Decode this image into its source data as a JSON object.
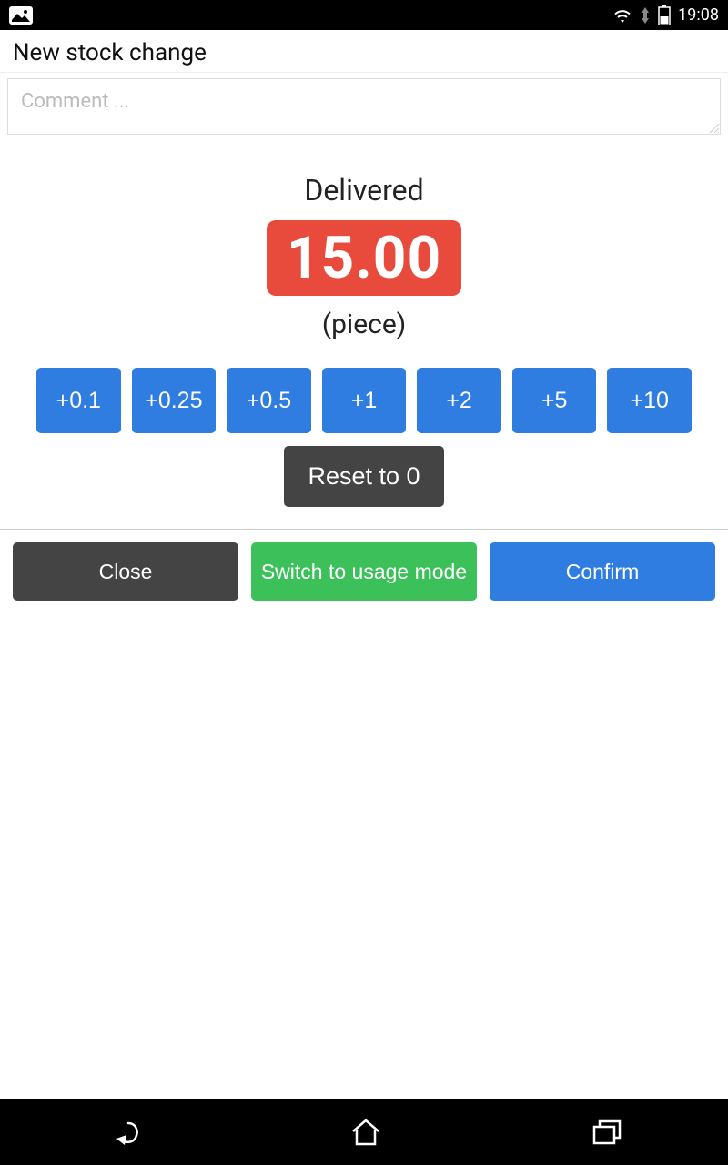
{
  "status_bar": {
    "time": "19:08"
  },
  "header": {
    "title": "New stock change"
  },
  "comment": {
    "placeholder": "Comment ...",
    "value": ""
  },
  "delivered": {
    "label": "Delivered",
    "value": "15.00",
    "unit": "(piece)"
  },
  "increments": [
    "+0.1",
    "+0.25",
    "+0.5",
    "+1",
    "+2",
    "+5",
    "+10"
  ],
  "reset_label": "Reset to 0",
  "actions": {
    "close": "Close",
    "switch": "Switch to usage mode",
    "confirm": "Confirm"
  },
  "colors": {
    "value_bg": "#e84b3c",
    "blue": "#2f7de1",
    "green": "#3cc05a",
    "dark": "#444444"
  }
}
